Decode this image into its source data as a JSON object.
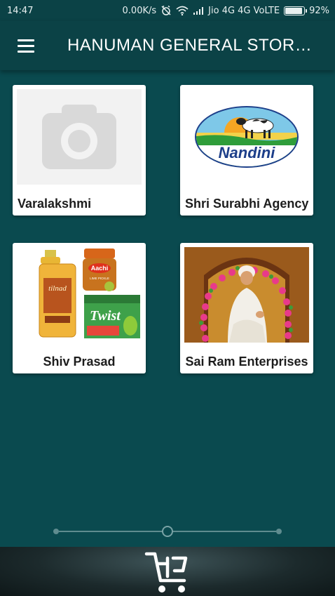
{
  "status_bar": {
    "time": "14:47",
    "speed": "0.00K/s",
    "carrier": "Jio 4G 4G VoLTE",
    "battery_text": "92%",
    "battery_level": 0.92
  },
  "app_bar": {
    "title": "HANUMAN GENERAL STORE..."
  },
  "stores": [
    {
      "name": "Varalakshmi",
      "image": "camera-placeholder-icon"
    },
    {
      "name": "Shri Surabhi Agency",
      "image": "nandini-logo",
      "logo_text": "Nandini"
    },
    {
      "name": "Shiv Prasad",
      "image": "grocery-products",
      "labels": [
        "tilnad",
        "Aachi",
        "LIME PICKLE",
        "Twist"
      ]
    },
    {
      "name": "Sai Ram Enterprises",
      "image": "sai-baba-shrine"
    }
  ],
  "pager": {
    "page_count": 3,
    "current_page": 2
  },
  "bottom_bar": {
    "icon": "cart-icon"
  },
  "colors": {
    "background": "#0a4a4f",
    "app_bar": "#0b4246",
    "card": "#ffffff",
    "label": "#1d1d1d"
  }
}
